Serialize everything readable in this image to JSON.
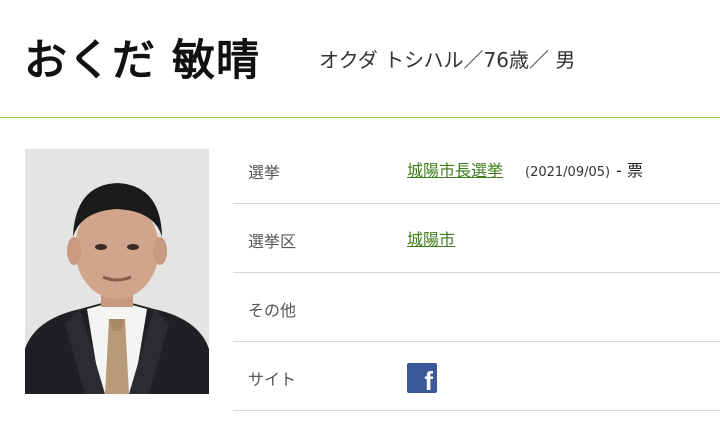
{
  "candidate": {
    "name": "おくだ 敏晴",
    "reading": "オクダ トシハル／76歳／ 男"
  },
  "info_rows": [
    {
      "label": "選挙",
      "link": "城陽市長選挙",
      "date": "(2021/09/05)",
      "votes": "- 票"
    },
    {
      "label": "選挙区",
      "link": "城陽市"
    },
    {
      "label": "その他"
    },
    {
      "label": "サイト",
      "icon": "facebook-icon"
    }
  ],
  "colors": {
    "accent_line": "#8cc63e",
    "link": "#3f7d1a",
    "facebook": "#3b5998"
  }
}
